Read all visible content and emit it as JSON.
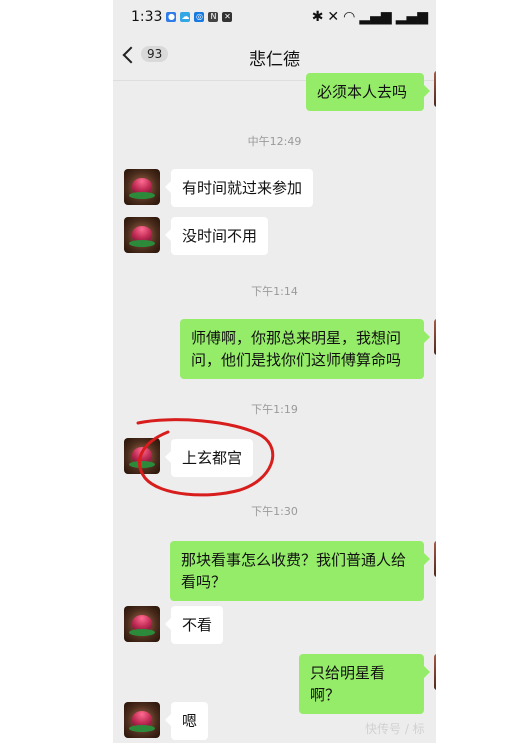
{
  "status": {
    "time": "1:33",
    "icons": [
      "app-icon",
      "cloud-icon",
      "blue-app-icon",
      "nfc-icon",
      "mute-icon",
      "bluetooth-icon",
      "silent-icon",
      "wifi-icon",
      "signal-icon",
      "signal-icon-2"
    ]
  },
  "header": {
    "back_count": "93",
    "title": "悲仁德"
  },
  "messages": [
    {
      "side": "out",
      "text": "必须本人去吗"
    },
    {
      "side": "time",
      "text": "中午12:49"
    },
    {
      "side": "in",
      "text": "有时间就过来参加"
    },
    {
      "side": "in",
      "text": "没时间不用"
    },
    {
      "side": "time",
      "text": "下午1:14"
    },
    {
      "side": "out",
      "text": "师傅啊，你那总来明星，我想问问，他们是找你们这师傅算命吗"
    },
    {
      "side": "time",
      "text": "下午1:19"
    },
    {
      "side": "in",
      "text": "上玄都宫"
    },
    {
      "side": "time",
      "text": "下午1:30"
    },
    {
      "side": "out",
      "text": "那块看事怎么收费？我们普通人给看吗？"
    },
    {
      "side": "in",
      "text": "不看"
    },
    {
      "side": "out",
      "text": "只给明星看啊？"
    },
    {
      "side": "in",
      "text": "嗯"
    }
  ],
  "watermark": "快传号 / 标"
}
